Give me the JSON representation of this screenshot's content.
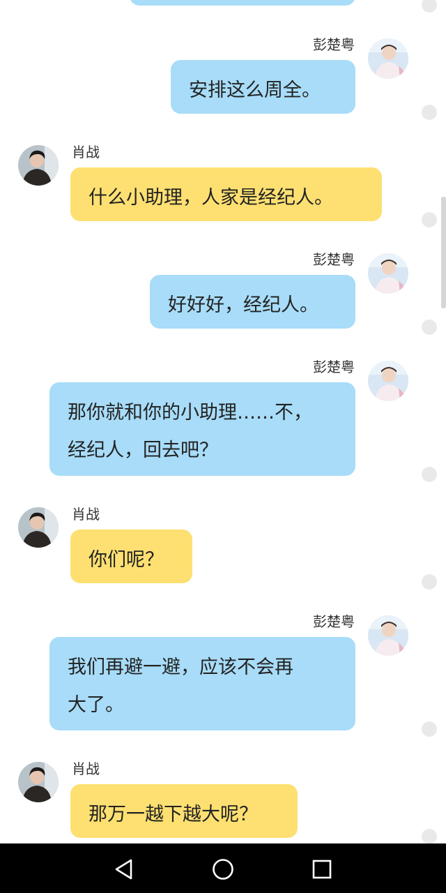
{
  "messages": [
    {
      "side": "right",
      "sender": "",
      "text": ""
    },
    {
      "side": "right",
      "sender": "彭楚粤",
      "text": "安排这么周全。"
    },
    {
      "side": "left",
      "sender": "肖战",
      "text": "什么小助理，人家是经纪人。"
    },
    {
      "side": "right",
      "sender": "彭楚粤",
      "text": "好好好，经纪人。"
    },
    {
      "side": "right",
      "sender": "彭楚粤",
      "text": "那你就和你的小助理……不，\n经纪人，回去吧？"
    },
    {
      "side": "left",
      "sender": "肖战",
      "text": "你们呢？"
    },
    {
      "side": "right",
      "sender": "彭楚粤",
      "text": "我们再避一避，应该不会再\n大了。"
    },
    {
      "side": "left",
      "sender": "肖战",
      "text": "那万一越下越大呢？"
    }
  ],
  "avatars": {
    "right": "avatar-peng-chuyue",
    "left": "avatar-xiao-zhan"
  },
  "colors": {
    "right_bubble": "#a8dcf8",
    "left_bubble": "#fde071",
    "nav_bar": "#000000"
  },
  "nav": {
    "back_icon": "triangle-back-icon",
    "home_icon": "circle-home-icon",
    "recents_icon": "square-recents-icon"
  }
}
